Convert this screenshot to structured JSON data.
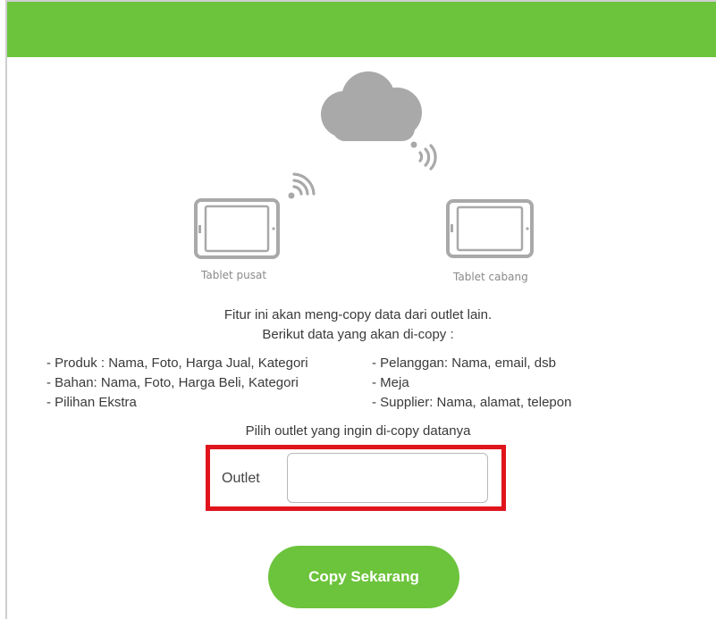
{
  "colors": {
    "header_green": "#6cc33c",
    "button_green": "#6cc33c",
    "highlight_red": "#e0141c",
    "icon_gray": "#a9a9a9"
  },
  "illustration": {
    "cloud_icon": "cloud-icon",
    "wifi_icon": "wifi-signal-icon",
    "tablet_icon": "tablet-icon",
    "tablet_left_label": "Tablet pusat",
    "tablet_right_label": "Tablet cabang"
  },
  "intro": {
    "line1": "Fitur ini akan meng-copy data dari outlet lain.",
    "line2": "Berikut data yang akan di-copy :"
  },
  "data_list": {
    "left": [
      "- Produk : Nama, Foto, Harga Jual, Kategori",
      "- Bahan: Nama, Foto, Harga Beli, Kategori",
      "- Pilihan Ekstra"
    ],
    "right": [
      "- Pelanggan: Nama, email, dsb",
      "- Meja",
      "- Supplier: Nama, alamat, telepon"
    ]
  },
  "outlet_select": {
    "prompt": "Pilih outlet yang ingin di-copy datanya",
    "label": "Outlet",
    "value": ""
  },
  "actions": {
    "copy_label": "Copy Sekarang"
  }
}
